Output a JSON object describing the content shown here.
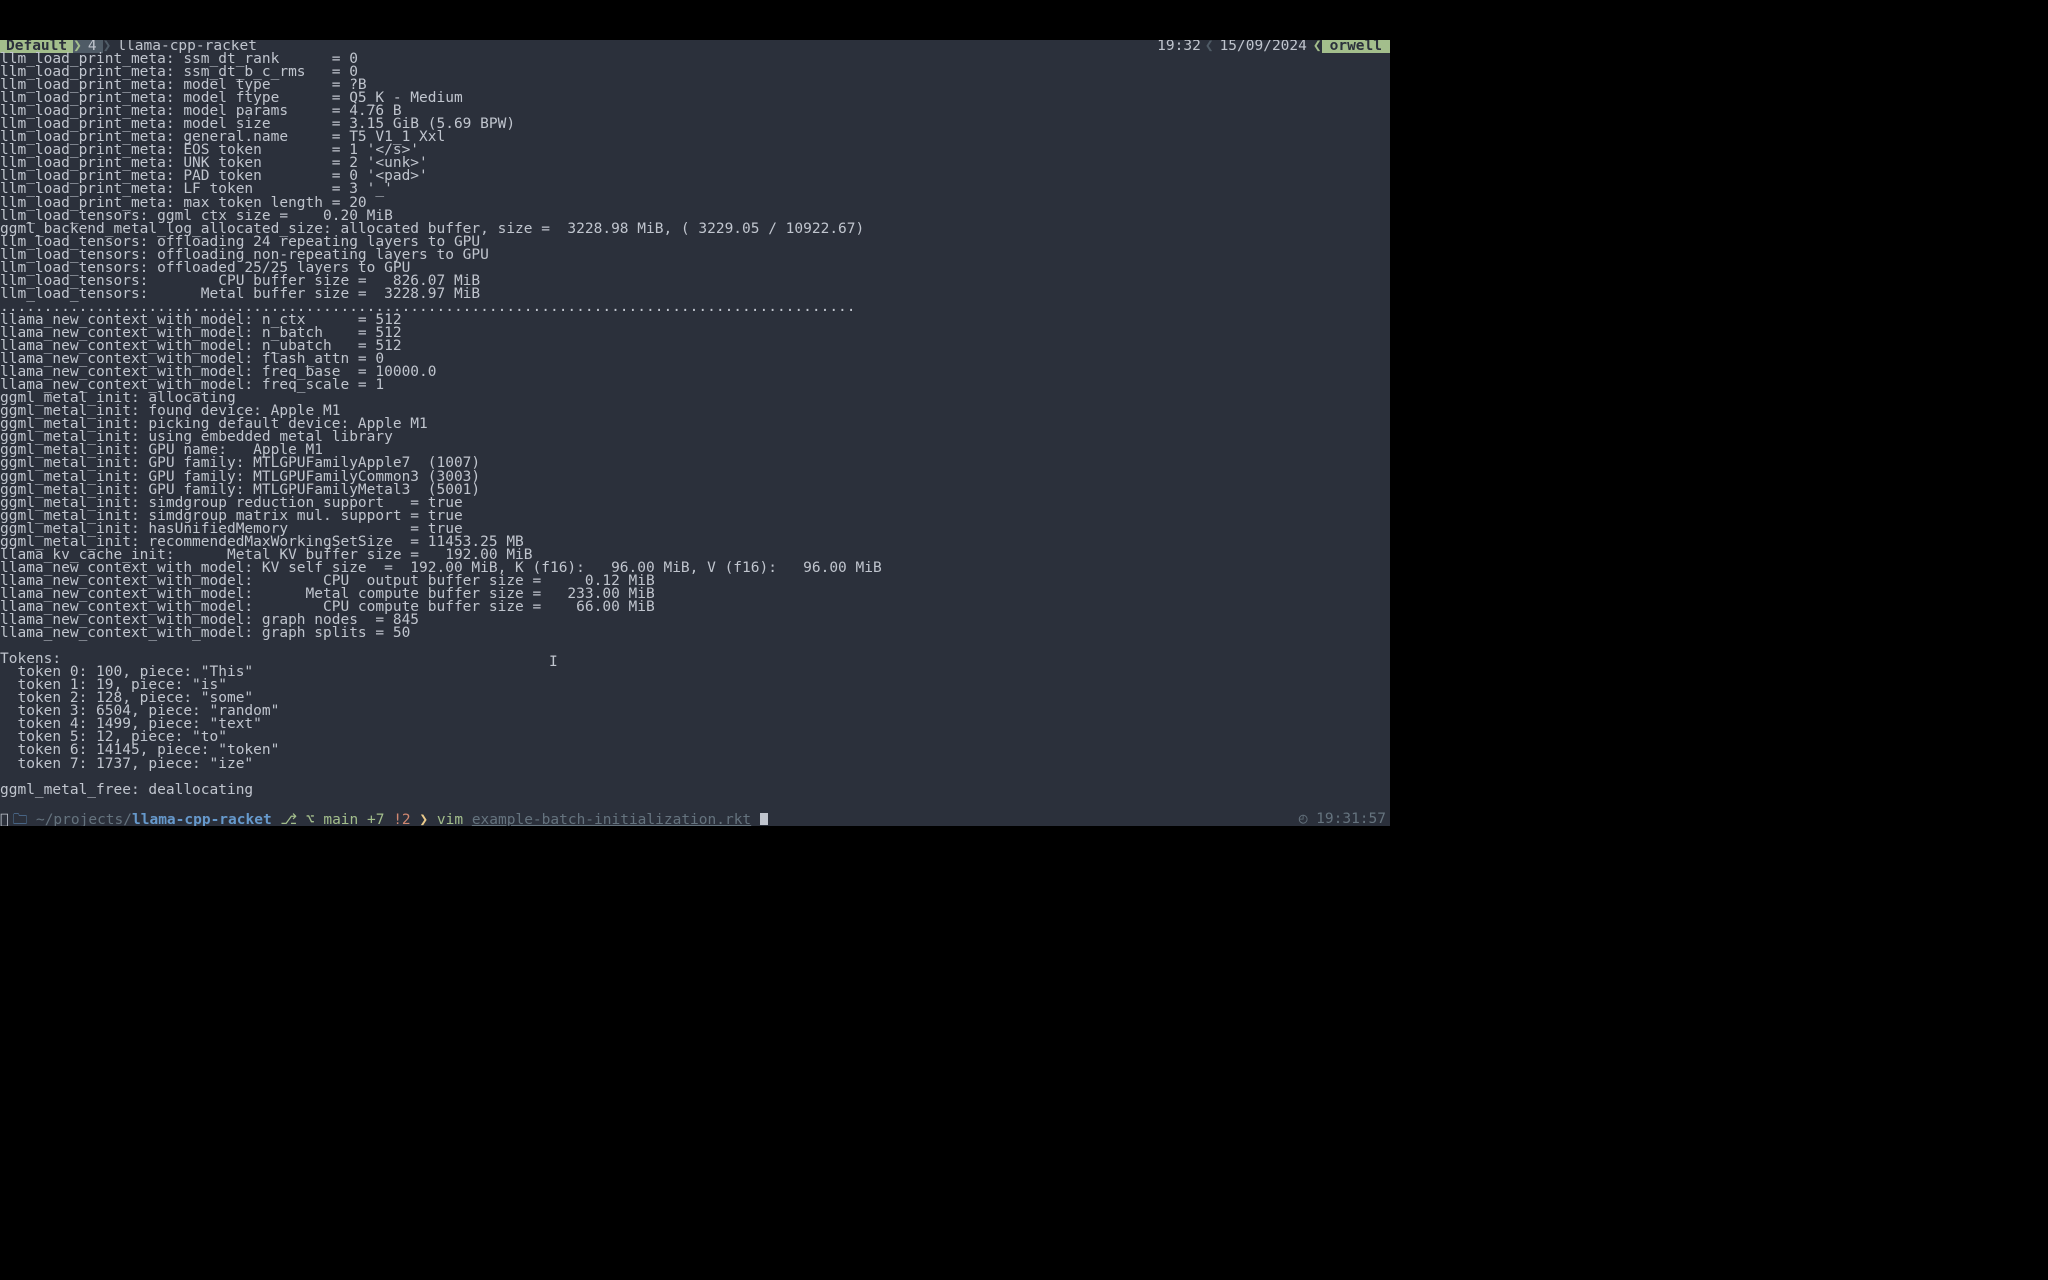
{
  "topbar": {
    "session": "Default",
    "window_num": "4",
    "tab": "llama-cpp-racket",
    "time": "19:32",
    "date": "15/09/2024",
    "host": "orwell"
  },
  "lines": [
    "llm_load_print_meta: ssm_dt_rank      = 0",
    "llm_load_print_meta: ssm_dt_b_c_rms   = 0",
    "llm_load_print_meta: model type       = ?B",
    "llm_load_print_meta: model ftype      = Q5_K - Medium",
    "llm_load_print_meta: model params     = 4.76 B",
    "llm_load_print_meta: model size       = 3.15 GiB (5.69 BPW)",
    "llm_load_print_meta: general.name     = T5 V1_1 Xxl",
    "llm_load_print_meta: EOS token        = 1 '</s>'",
    "llm_load_print_meta: UNK token        = 2 '<unk>'",
    "llm_load_print_meta: PAD token        = 0 '<pad>'",
    "llm_load_print_meta: LF token         = 3 '_'",
    "llm_load_print_meta: max token length = 20",
    "llm_load_tensors: ggml ctx size =    0.20 MiB",
    "ggml_backend_metal_log_allocated_size: allocated buffer, size =  3228.98 MiB, ( 3229.05 / 10922.67)",
    "llm_load_tensors: offloading 24 repeating layers to GPU",
    "llm_load_tensors: offloading non-repeating layers to GPU",
    "llm_load_tensors: offloaded 25/25 layers to GPU",
    "llm_load_tensors:        CPU buffer size =   826.07 MiB",
    "llm_load_tensors:      Metal buffer size =  3228.97 MiB",
    "..................................................................................................",
    "llama_new_context_with_model: n_ctx      = 512",
    "llama_new_context_with_model: n_batch    = 512",
    "llama_new_context_with_model: n_ubatch   = 512",
    "llama_new_context_with_model: flash_attn = 0",
    "llama_new_context_with_model: freq_base  = 10000.0",
    "llama_new_context_with_model: freq_scale = 1",
    "ggml_metal_init: allocating",
    "ggml_metal_init: found device: Apple M1",
    "ggml_metal_init: picking default device: Apple M1",
    "ggml_metal_init: using embedded metal library",
    "ggml_metal_init: GPU name:   Apple M1",
    "ggml_metal_init: GPU family: MTLGPUFamilyApple7  (1007)",
    "ggml_metal_init: GPU family: MTLGPUFamilyCommon3 (3003)",
    "ggml_metal_init: GPU family: MTLGPUFamilyMetal3  (5001)",
    "ggml_metal_init: simdgroup reduction support   = true",
    "ggml_metal_init: simdgroup matrix mul. support = true",
    "ggml_metal_init: hasUnifiedMemory              = true",
    "ggml_metal_init: recommendedMaxWorkingSetSize  = 11453.25 MB",
    "llama_kv_cache_init:      Metal KV buffer size =   192.00 MiB",
    "llama_new_context_with_model: KV self size  =  192.00 MiB, K (f16):   96.00 MiB, V (f16):   96.00 MiB",
    "llama_new_context_with_model:        CPU  output buffer size =     0.12 MiB",
    "llama_new_context_with_model:      Metal compute buffer size =   233.00 MiB",
    "llama_new_context_with_model:        CPU compute buffer size =    66.00 MiB",
    "llama_new_context_with_model: graph nodes  = 845",
    "llama_new_context_with_model: graph splits = 50",
    "",
    "Tokens:",
    "  token 0: 100, piece: \"This\"",
    "  token 1: 19, piece: \"is\"",
    "  token 2: 128, piece: \"some\"",
    "  token 3: 6504, piece: \"random\"",
    "  token 4: 1499, piece: \"text\"",
    "  token 5: 12, piece: \"to\"",
    "  token 6: 14145, piece: \"token\"",
    "  token 7: 1737, piece: \"ize\"",
    "",
    "ggml_metal_free: deallocating",
    ""
  ],
  "prompt": {
    "path_prefix": "~/projects/",
    "path_repo": "llama-cpp-racket",
    "branch": "main",
    "ahead": "+7",
    "dirty": "!2",
    "cmd": "vim",
    "arg": "example-batch-initialization.rkt",
    "right_time": "19:31:57"
  }
}
